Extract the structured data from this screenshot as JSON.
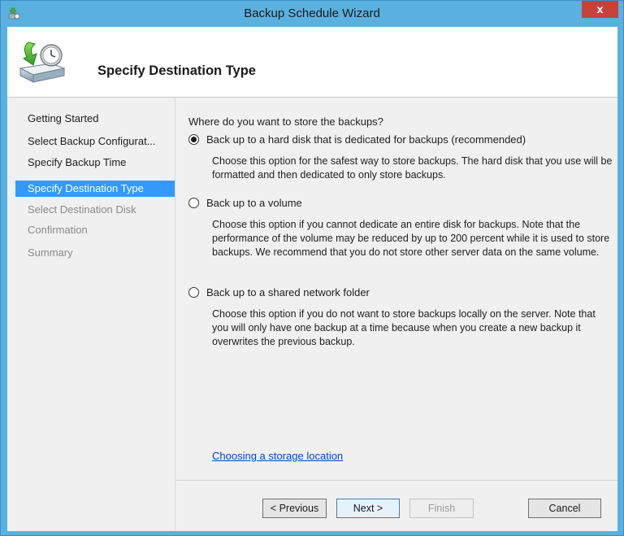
{
  "window": {
    "title": "Backup Schedule Wizard",
    "close_label": "x"
  },
  "header": {
    "title": "Specify Destination Type"
  },
  "nav": {
    "items": [
      {
        "label": "Getting Started",
        "state": "completed"
      },
      {
        "label": "Select Backup Configurat...",
        "state": "completed"
      },
      {
        "label": "Specify Backup Time",
        "state": "completed"
      },
      {
        "label": "Specify Destination Type",
        "state": "current"
      },
      {
        "label": "Select Destination Disk",
        "state": "disabled"
      },
      {
        "label": "Confirmation",
        "state": "disabled"
      },
      {
        "label": "Summary",
        "state": "disabled"
      }
    ]
  },
  "content": {
    "question": "Where do you want to store the backups?",
    "options": [
      {
        "label": "Back up to a hard disk that is dedicated for backups (recommended)",
        "description": "Choose this option for the safest way to store backups. The hard disk that you use will be formatted and then dedicated to only store backups.",
        "selected": true
      },
      {
        "label": "Back up to a volume",
        "description": "Choose this option if you cannot dedicate an entire disk for backups. Note that the performance of the volume may be reduced by up to 200 percent while it is used to store backups. We recommend that you do not store other server data on the same volume.",
        "selected": false
      },
      {
        "label": "Back up to a shared network folder",
        "description": "Choose this option if you do not want to store backups locally on the server. Note that you will only have one backup at a time because when you create a new backup it overwrites the previous backup.",
        "selected": false
      }
    ],
    "help_link": "Choosing a storage location"
  },
  "buttons": {
    "previous": "< Previous",
    "next": "Next >",
    "finish": "Finish",
    "cancel": "Cancel"
  },
  "colors": {
    "title_bar": "#5ab1e0",
    "close_button": "#c7403b",
    "nav_selected": "#3399ff",
    "link": "#0044cc"
  }
}
